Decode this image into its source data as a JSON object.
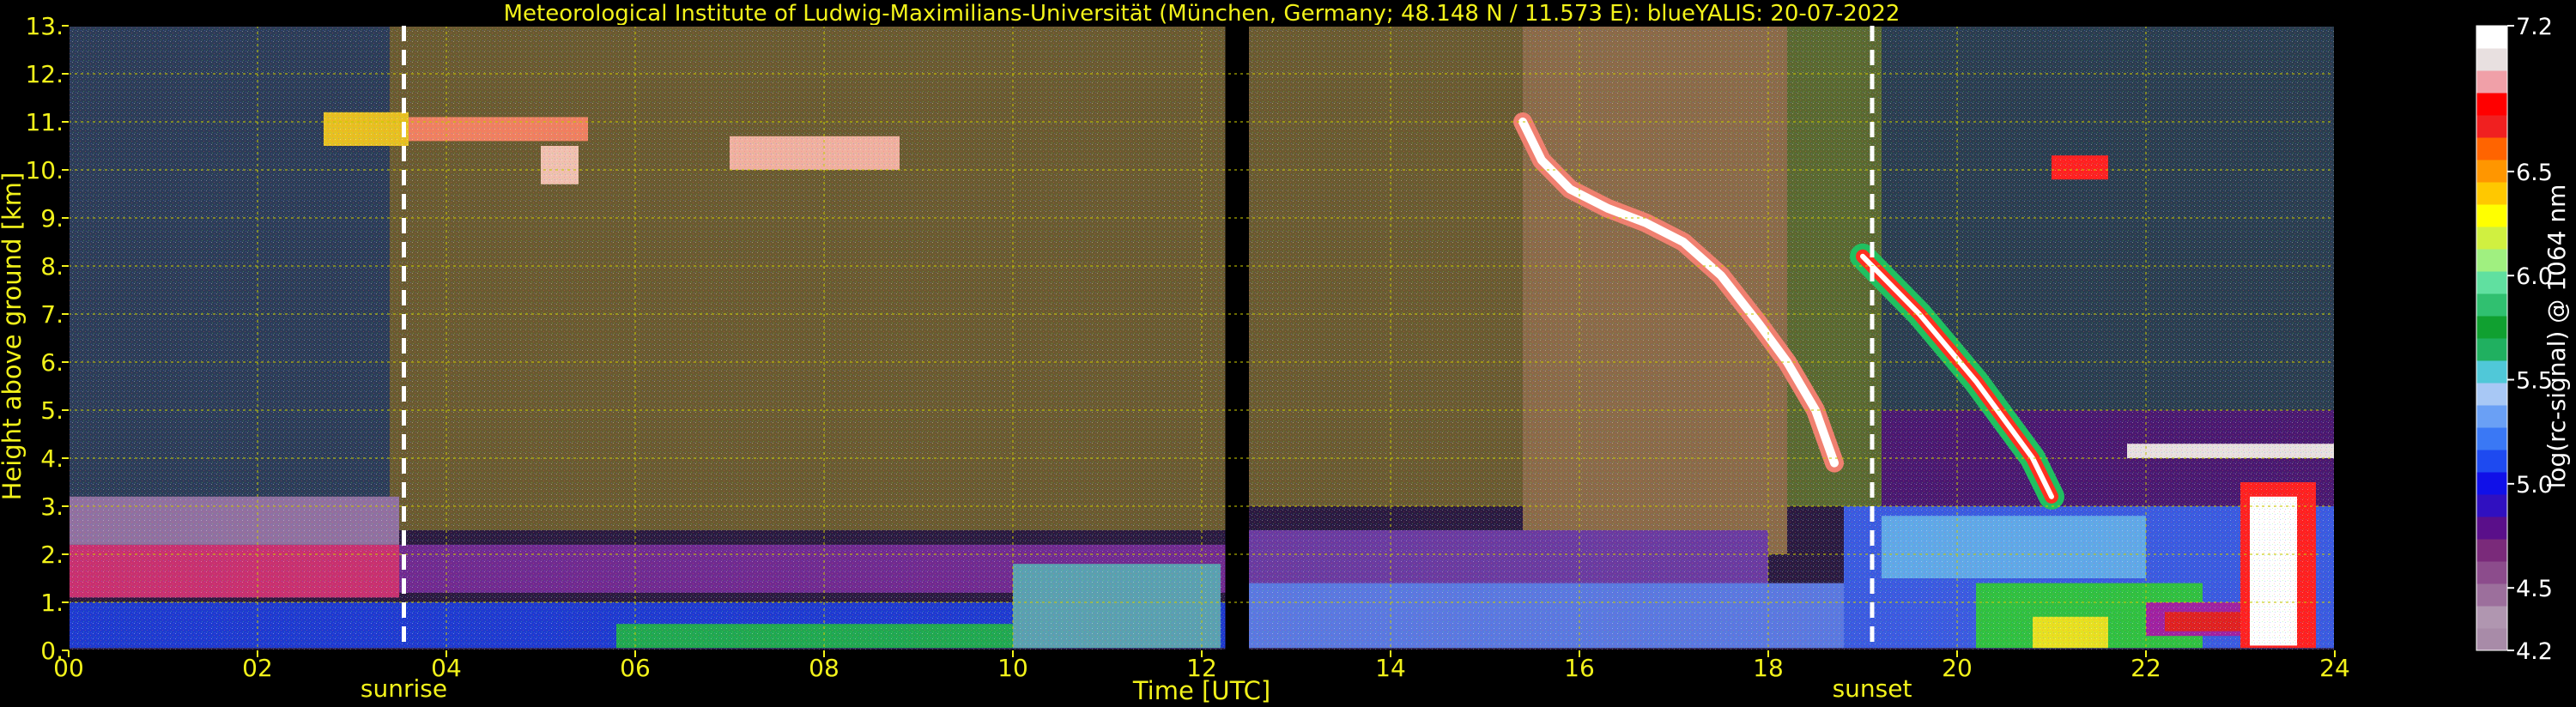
{
  "chart_data": {
    "type": "heatmap",
    "title": "Meteorological Institute of Ludwig-Maximilians-Universität (München, Germany; 48.148 N / 11.573 E):     blueYALIS: 20-07-2022",
    "xlabel": "Time [UTC]",
    "ylabel": "Height above ground [km]",
    "xlim": [
      0,
      24
    ],
    "ylim": [
      0,
      13
    ],
    "x_ticks": [
      {
        "value": 0,
        "label": "00"
      },
      {
        "value": 2,
        "label": "02"
      },
      {
        "value": 4,
        "label": "04"
      },
      {
        "value": 6,
        "label": "06"
      },
      {
        "value": 8,
        "label": "08"
      },
      {
        "value": 10,
        "label": "10"
      },
      {
        "value": 12,
        "label": "12"
      },
      {
        "value": 14,
        "label": "14"
      },
      {
        "value": 16,
        "label": "16"
      },
      {
        "value": 18,
        "label": "18"
      },
      {
        "value": 20,
        "label": "20"
      },
      {
        "value": 22,
        "label": "22"
      },
      {
        "value": 24,
        "label": "24"
      }
    ],
    "y_ticks": [
      {
        "value": 0,
        "label": "0."
      },
      {
        "value": 1,
        "label": "1."
      },
      {
        "value": 2,
        "label": "2."
      },
      {
        "value": 3,
        "label": "3."
      },
      {
        "value": 4,
        "label": "4."
      },
      {
        "value": 5,
        "label": "5."
      },
      {
        "value": 6,
        "label": "6."
      },
      {
        "value": 7,
        "label": "7."
      },
      {
        "value": 8,
        "label": "8."
      },
      {
        "value": 9,
        "label": "9."
      },
      {
        "value": 10,
        "label": "10."
      },
      {
        "value": 11,
        "label": "11."
      },
      {
        "value": 12,
        "label": "12."
      },
      {
        "value": 13,
        "label": "13."
      }
    ],
    "grid": true,
    "markers": [
      {
        "label": "sunrise",
        "time": 3.55
      },
      {
        "label": "sunset",
        "time": 19.1
      }
    ],
    "data_gap": [
      12.25,
      12.5
    ],
    "colorbar": {
      "label": "log(rc-signal) @ 1064 nm",
      "range": [
        4.2,
        7.2
      ],
      "ticks": [
        {
          "value": 4.2,
          "label": "4.2"
        },
        {
          "value": 4.5,
          "label": "4.5"
        },
        {
          "value": 5.0,
          "label": "5.0"
        },
        {
          "value": 5.5,
          "label": "5.5"
        },
        {
          "value": 6.0,
          "label": "6.0"
        },
        {
          "value": 6.5,
          "label": "6.5"
        },
        {
          "value": 7.2,
          "label": "7.2"
        }
      ],
      "colors": [
        "#a88ba8",
        "#b096b0",
        "#9c6f9c",
        "#8c4c8c",
        "#7a2a7a",
        "#5a0f8a",
        "#3010c0",
        "#1010e8",
        "#1e4af0",
        "#3a78f5",
        "#6aa0f5",
        "#a8c8f5",
        "#50c8d8",
        "#20b060",
        "#10a030",
        "#30c070",
        "#60e0a0",
        "#a0f080",
        "#d0f040",
        "#ffff00",
        "#ffc800",
        "#ff9600",
        "#ff6400",
        "#f02020",
        "#ff0000",
        "#f0a0a8",
        "#e8e0e0",
        "#ffffff"
      ]
    },
    "regions": [
      {
        "t0": 0,
        "t1": 24,
        "h0": 0,
        "h1": 13,
        "color": "#2a1a40"
      },
      {
        "t0": 0,
        "t1": 3.4,
        "h0": 2,
        "h1": 13,
        "color": "#2c3c58"
      },
      {
        "t0": 3.4,
        "t1": 12.25,
        "h0": 2.5,
        "h1": 13,
        "color": "#6a5a30"
      },
      {
        "t0": 12.5,
        "t1": 15.4,
        "h0": 3,
        "h1": 13,
        "color": "#6a5a30"
      },
      {
        "t0": 15.4,
        "t1": 18.2,
        "h0": 2,
        "h1": 13,
        "color": "#8a6a48"
      },
      {
        "t0": 18.2,
        "t1": 19.2,
        "h0": 3,
        "h1": 13,
        "color": "#5a6830"
      },
      {
        "t0": 19.2,
        "t1": 24,
        "h0": 5,
        "h1": 13,
        "color": "#2a3d50"
      },
      {
        "t0": 19.2,
        "t1": 24,
        "h0": 3,
        "h1": 5,
        "color": "#4a1870"
      },
      {
        "t0": 0,
        "t1": 3.5,
        "h0": 1.1,
        "h1": 2.2,
        "color": "#c83070"
      },
      {
        "t0": 0,
        "t1": 3.5,
        "h0": 2.2,
        "h1": 3.2,
        "color": "#9070a0"
      },
      {
        "t0": 3.5,
        "t1": 12.25,
        "h0": 1.2,
        "h1": 2.2,
        "color": "#702a90"
      },
      {
        "t0": 12.5,
        "t1": 18,
        "h0": 1.2,
        "h1": 2.5,
        "color": "#6a3aa0"
      },
      {
        "t0": 0,
        "t1": 12.25,
        "h0": 0.05,
        "h1": 1.0,
        "color": "#1e3ad0"
      },
      {
        "t0": 12.5,
        "t1": 18.8,
        "h0": 0.05,
        "h1": 1.4,
        "color": "#5a78e0"
      },
      {
        "t0": 18.8,
        "t1": 24,
        "h0": 0.05,
        "h1": 3.0,
        "color": "#3a5ae0"
      },
      {
        "t0": 19.2,
        "t1": 22,
        "h0": 1.5,
        "h1": 2.8,
        "color": "#60a8e8"
      },
      {
        "t0": 5.8,
        "t1": 10.5,
        "h0": 0.05,
        "h1": 0.55,
        "color": "#20a850"
      },
      {
        "t0": 10.0,
        "t1": 12.2,
        "h0": 0.05,
        "h1": 1.8,
        "color": "#5aa0b0"
      },
      {
        "t0": 20.2,
        "t1": 22.6,
        "h0": 0.05,
        "h1": 1.4,
        "color": "#30c040"
      },
      {
        "t0": 20.8,
        "t1": 21.6,
        "h0": 0.05,
        "h1": 0.7,
        "color": "#e8e020"
      },
      {
        "t0": 22.0,
        "t1": 23.2,
        "h0": 0.3,
        "h1": 1.0,
        "color": "#a020a0"
      },
      {
        "t0": 22.2,
        "t1": 23.0,
        "h0": 0.4,
        "h1": 0.8,
        "color": "#e02020"
      },
      {
        "t0": 23.0,
        "t1": 23.8,
        "h0": 0.05,
        "h1": 3.5,
        "color": "#ff2020"
      },
      {
        "t0": 23.1,
        "t1": 23.6,
        "h0": 0.1,
        "h1": 3.2,
        "color": "#ffffff"
      },
      {
        "t0": 21.8,
        "t1": 24,
        "h0": 4.0,
        "h1": 4.3,
        "color": "#e8e0e0"
      },
      {
        "t0": 2.7,
        "t1": 3.6,
        "h0": 10.5,
        "h1": 11.2,
        "color": "#e8c020"
      },
      {
        "t0": 3.6,
        "t1": 5.5,
        "h0": 10.6,
        "h1": 11.1,
        "color": "#f08060"
      },
      {
        "t0": 5.0,
        "t1": 5.4,
        "h0": 9.7,
        "h1": 10.5,
        "color": "#f0c0b0"
      },
      {
        "t0": 7.0,
        "t1": 8.8,
        "h0": 10.0,
        "h1": 10.7,
        "color": "#f0b0a0"
      },
      {
        "t0": 21.0,
        "t1": 21.6,
        "h0": 9.8,
        "h1": 10.3,
        "color": "#ff2020"
      }
    ],
    "cloud_trail": [
      [
        15.4,
        11.0
      ],
      [
        15.6,
        10.2
      ],
      [
        15.9,
        9.6
      ],
      [
        16.3,
        9.2
      ],
      [
        16.7,
        8.9
      ],
      [
        17.1,
        8.5
      ],
      [
        17.5,
        7.8
      ],
      [
        17.9,
        6.8
      ],
      [
        18.2,
        6.0
      ],
      [
        18.5,
        5.0
      ],
      [
        18.7,
        3.9
      ]
    ],
    "convective_trail": [
      [
        19.0,
        8.2
      ],
      [
        19.3,
        7.6
      ],
      [
        19.6,
        7.0
      ],
      [
        19.9,
        6.3
      ],
      [
        20.2,
        5.6
      ],
      [
        20.5,
        4.8
      ],
      [
        20.8,
        4.0
      ],
      [
        21.0,
        3.2
      ]
    ]
  }
}
